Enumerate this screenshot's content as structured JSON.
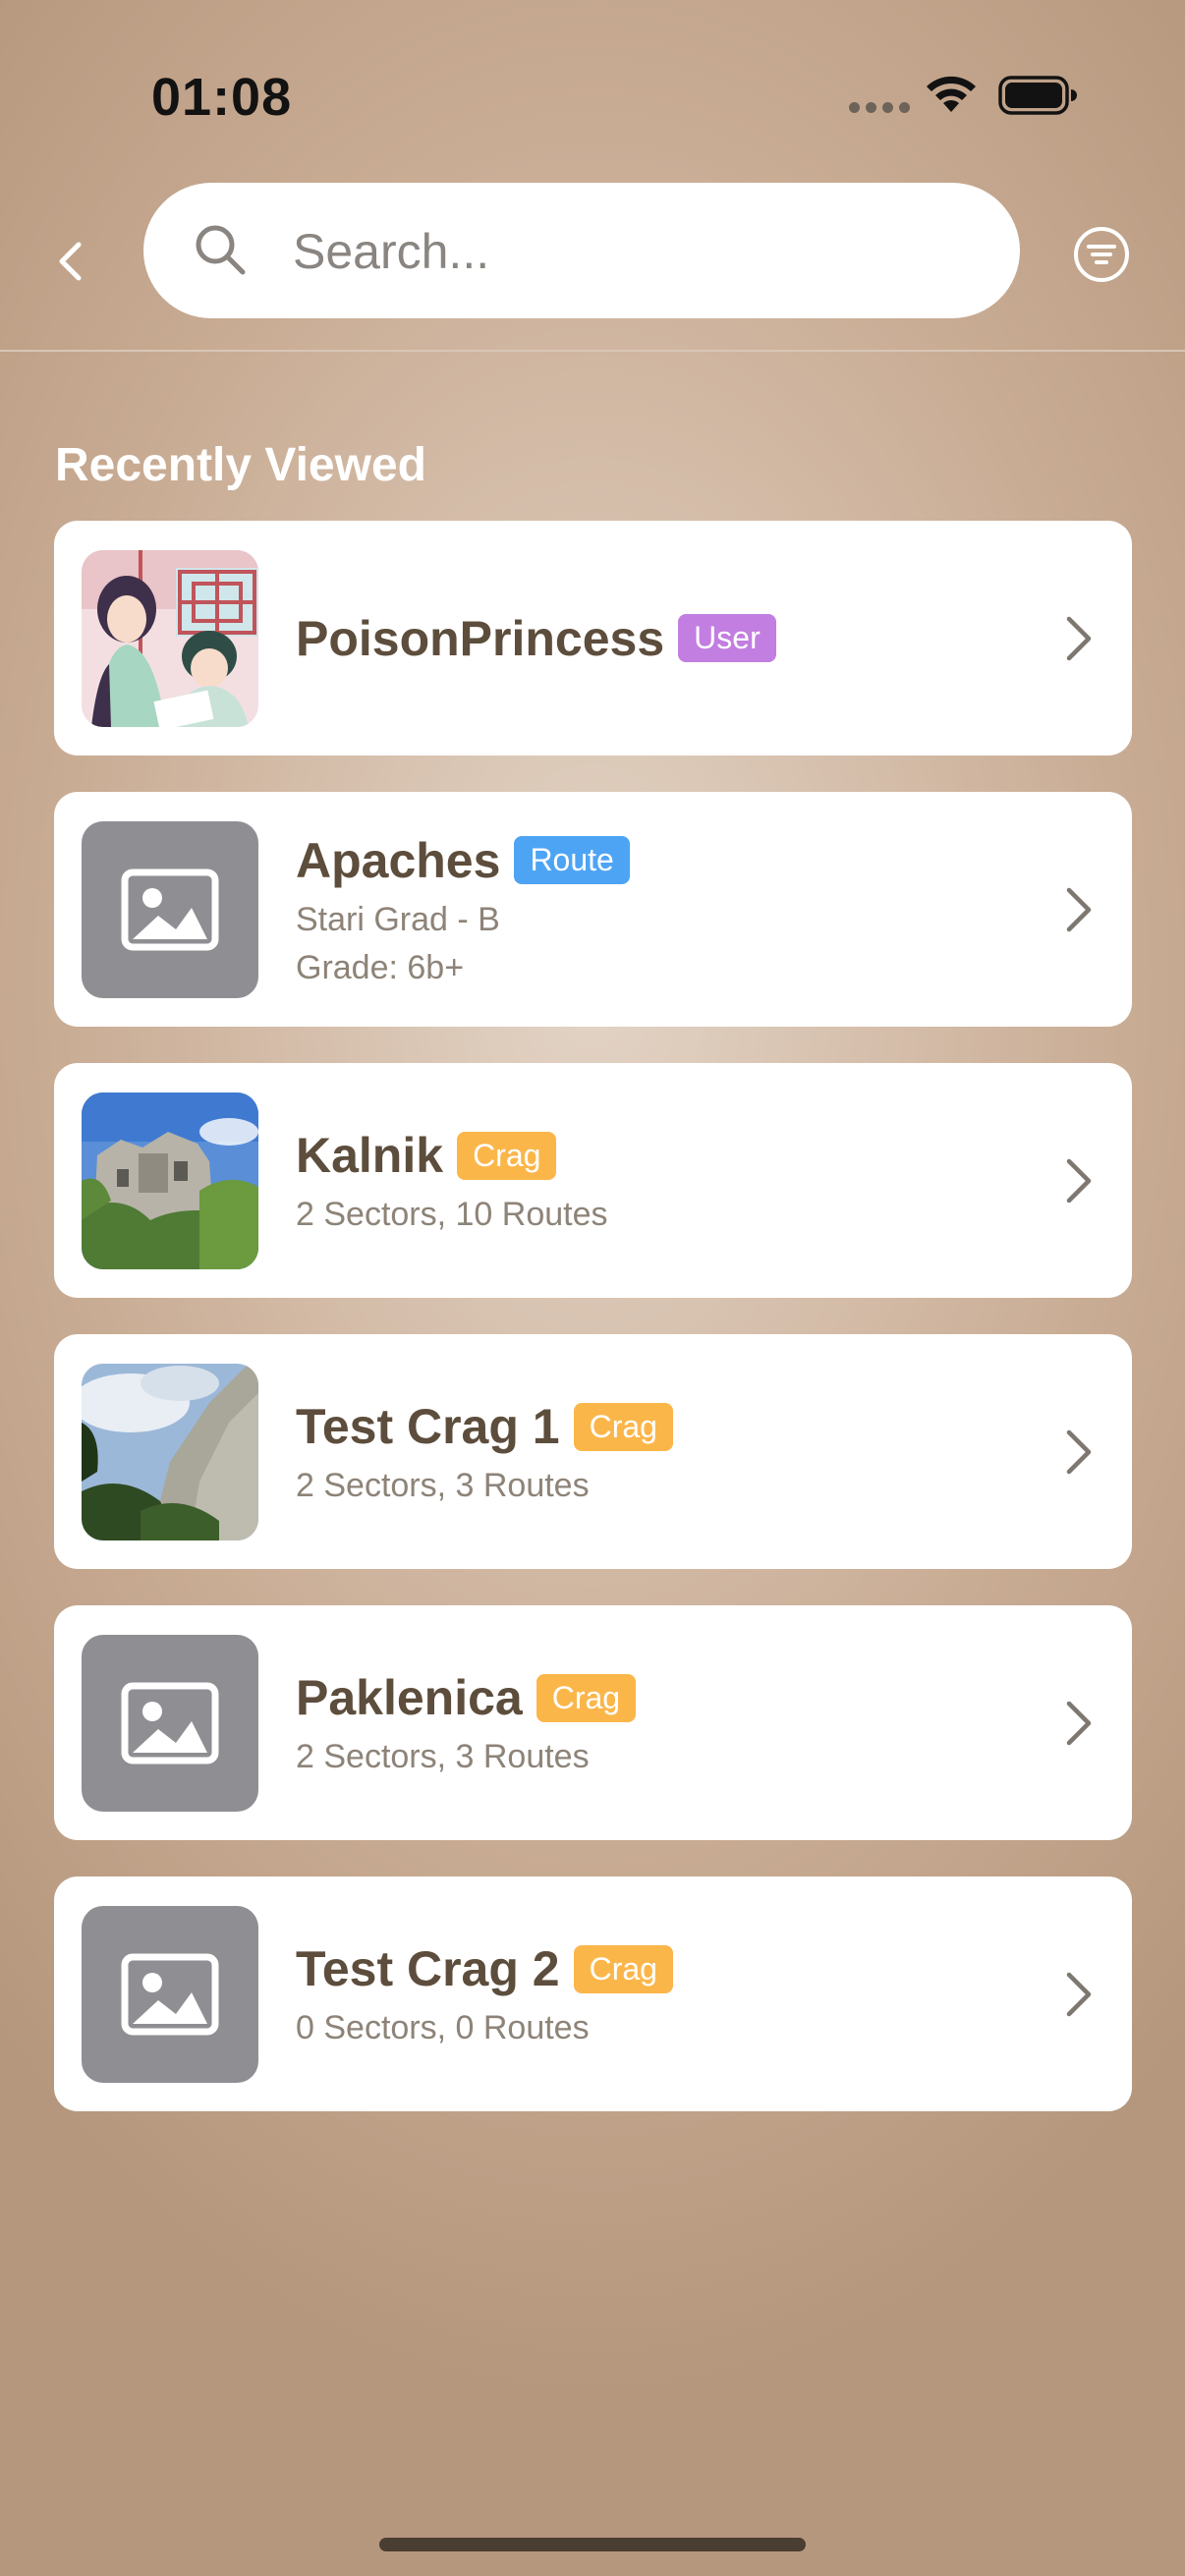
{
  "status_bar": {
    "time": "01:08"
  },
  "search": {
    "placeholder": "Search..."
  },
  "section": {
    "title": "Recently Viewed"
  },
  "colors": {
    "user_badge": "#c27ee0",
    "route_badge": "#4ea4f4",
    "crag_badge": "#fbb64a",
    "placeholder_thumb": "#8e8e93"
  },
  "items": [
    {
      "name": "PoisonPrincess",
      "badge": "User",
      "badge_color": "#c27ee0",
      "thumbnail": "anime-avatar-image",
      "subtitle": "",
      "detail": ""
    },
    {
      "name": "Apaches",
      "badge": "Route",
      "badge_color": "#4ea4f4",
      "thumbnail": "placeholder-image-icon",
      "subtitle": "Stari Grad - B",
      "detail": "Grade: 6b+"
    },
    {
      "name": "Kalnik",
      "badge": "Crag",
      "badge_color": "#fbb64a",
      "thumbnail": "castle-ruins-photo",
      "subtitle": "2 Sectors, 10 Routes",
      "detail": ""
    },
    {
      "name": "Test Crag 1",
      "badge": "Crag",
      "badge_color": "#fbb64a",
      "thumbnail": "cliff-photo",
      "subtitle": "2 Sectors, 3 Routes",
      "detail": ""
    },
    {
      "name": "Paklenica",
      "badge": "Crag",
      "badge_color": "#fbb64a",
      "thumbnail": "placeholder-image-icon",
      "subtitle": "2 Sectors, 3 Routes",
      "detail": ""
    },
    {
      "name": "Test Crag 2",
      "badge": "Crag",
      "badge_color": "#fbb64a",
      "thumbnail": "placeholder-image-icon",
      "subtitle": "0 Sectors, 0 Routes",
      "detail": ""
    }
  ]
}
